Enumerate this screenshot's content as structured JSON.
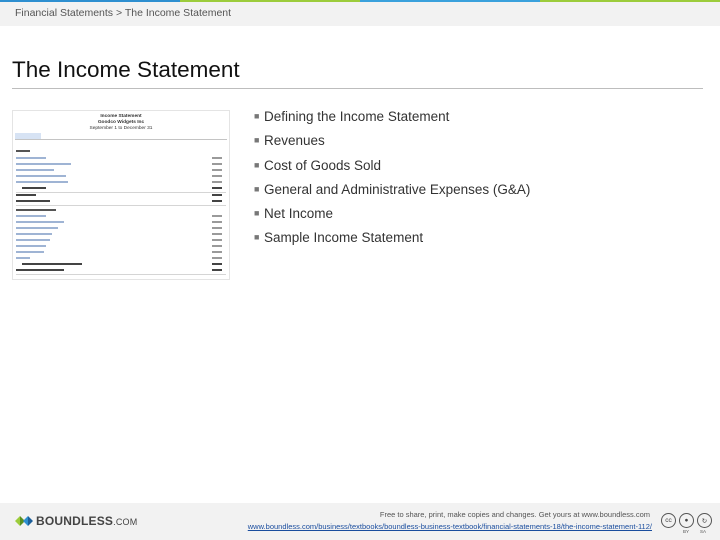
{
  "header": {
    "breadcrumb": "Financial Statements > The Income Statement",
    "bar_colors": [
      "#2e8fd0",
      "#9ccc3c",
      "#3aa1dc",
      "#9ccc3c"
    ]
  },
  "slide": {
    "title": "The Income Statement"
  },
  "thumbnail": {
    "title_line1": "Income Statement",
    "title_line2": "Goodco Widgets Inc",
    "period": "September 1 to December 31"
  },
  "bullets": [
    "Defining the Income Statement",
    "Revenues",
    "Cost of Goods Sold",
    "General and Administrative Expenses (G&A)",
    "Net Income",
    "Sample Income Statement"
  ],
  "footer": {
    "brand": "BOUNDLESS",
    "brand_suffix": ".COM",
    "share_text": "Free to share, print, make copies and changes. Get yours at www.boundless.com",
    "url": "www.boundless.com/business/textbooks/boundless-business-textbook/financial-statements-18/the-income-statement-112/",
    "license": {
      "cc": "cc",
      "by": "BY",
      "sa": "SA"
    }
  }
}
